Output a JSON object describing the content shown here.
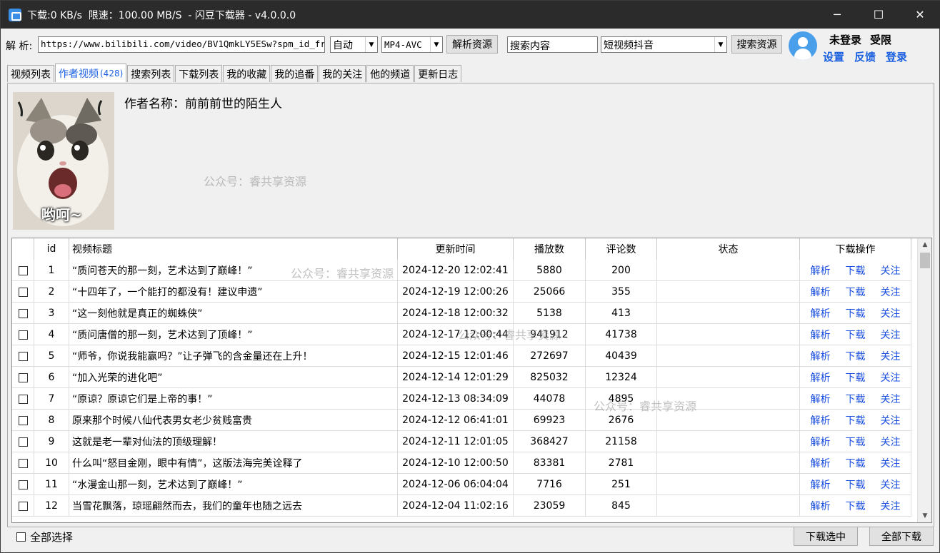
{
  "window": {
    "title": "下载:0 KB/s  限速：100.00 MB/S  - 闪豆下载器 - v4.0.0.0",
    "minimize": "─",
    "maximize": "☐",
    "close": "✕"
  },
  "toolbar": {
    "parse_label": "解 析:",
    "url_value": "https://www.bilibili.com/video/BV1QmkLY5ESw?spm_id_fr",
    "quality_select": "自动",
    "format_select": "MP4-AVC",
    "parse_button": "解析资源",
    "search_value": "搜索内容",
    "platform_select": "短视频抖音",
    "search_button": "搜索资源"
  },
  "user": {
    "status": "未登录",
    "limit": "受限",
    "settings": "设置",
    "feedback": "反馈",
    "login": "登录"
  },
  "tabs": [
    {
      "label": "视频列表"
    },
    {
      "label": "作者视频",
      "count": "(428)"
    },
    {
      "label": "搜索列表"
    },
    {
      "label": "下载列表"
    },
    {
      "label": "我的收藏"
    },
    {
      "label": "我的追番"
    },
    {
      "label": "我的关注"
    },
    {
      "label": "他的频道"
    },
    {
      "label": "更新日志"
    }
  ],
  "author": {
    "name": "作者名称：前前前世的陌生人",
    "thumb_caption": "哟呵~"
  },
  "watermarks": [
    "公众号：睿共享资源",
    "公众号：睿共享资源",
    "公众号：睿共享资源",
    "公众号：睿共享资源"
  ],
  "table": {
    "columns": [
      "",
      "id",
      "视频标题",
      "更新时间",
      "播放数",
      "评论数",
      "状态",
      "下载操作"
    ],
    "ops": [
      "解析",
      "下载",
      "关注"
    ],
    "rows": [
      {
        "id": "1",
        "title": "“质问苍天的那一刻，艺术达到了巅峰！”",
        "time": "2024-12-20 12:02:41",
        "plays": "5880",
        "comments": "200",
        "status": ""
      },
      {
        "id": "2",
        "title": "“十四年了，一个能打的都没有！建议申遗”",
        "time": "2024-12-19 12:00:26",
        "plays": "25066",
        "comments": "355",
        "status": ""
      },
      {
        "id": "3",
        "title": "“这一刻他就是真正的蜘蛛侠”",
        "time": "2024-12-18 12:00:32",
        "plays": "5138",
        "comments": "413",
        "status": ""
      },
      {
        "id": "4",
        "title": "“质问唐僧的那一刻，艺术达到了顶峰！”",
        "time": "2024-12-17 12:00:44",
        "plays": "941912",
        "comments": "41738",
        "status": ""
      },
      {
        "id": "5",
        "title": "“师爷，你说我能赢吗？”让子弹飞的含金量还在上升！",
        "time": "2024-12-15 12:01:46",
        "plays": "272697",
        "comments": "40439",
        "status": ""
      },
      {
        "id": "6",
        "title": "“加入光荣的进化吧”",
        "time": "2024-12-14 12:01:29",
        "plays": "825032",
        "comments": "12324",
        "status": ""
      },
      {
        "id": "7",
        "title": "“原谅？原谅它们是上帝的事！”",
        "time": "2024-12-13 08:34:09",
        "plays": "44078",
        "comments": "4895",
        "status": ""
      },
      {
        "id": "8",
        "title": "原来那个时候八仙代表男女老少贫贱富贵",
        "time": "2024-12-12 06:41:01",
        "plays": "69923",
        "comments": "2676",
        "status": ""
      },
      {
        "id": "9",
        "title": "这就是老一辈对仙法的顶级理解！",
        "time": "2024-12-11 12:01:05",
        "plays": "368427",
        "comments": "21158",
        "status": ""
      },
      {
        "id": "10",
        "title": "什么叫“怒目金刚，眼中有情”，这版法海完美诠释了",
        "time": "2024-12-10 12:00:50",
        "plays": "83381",
        "comments": "2781",
        "status": ""
      },
      {
        "id": "11",
        "title": "“水漫金山那一刻，艺术达到了巅峰！”",
        "time": "2024-12-06 06:04:04",
        "plays": "7716",
        "comments": "251",
        "status": ""
      },
      {
        "id": "12",
        "title": "当雪花飘落，琼瑶翩然而去，我们的童年也随之远去",
        "time": "2024-12-04 11:02:16",
        "plays": "23059",
        "comments": "845",
        "status": ""
      }
    ]
  },
  "bottom": {
    "select_all": "全部选择",
    "download_selected": "下载选中",
    "download_all": "全部下载"
  },
  "colors": {
    "titlebar": "#2b2b2b",
    "link_blue": "#1a4fe0",
    "avatar_blue": "#4a9fea"
  }
}
